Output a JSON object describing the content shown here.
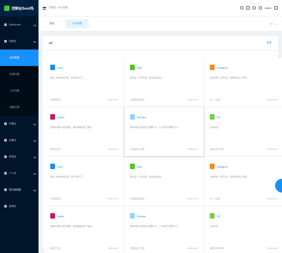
{
  "sidebar": {
    "logo_text": "控制台Seed鸟",
    "items": [
      {
        "label": "Dashboard",
        "expanded": false
      },
      {
        "label": "列表页",
        "expanded": true,
        "children": [
          {
            "label": "查询表格",
            "active": true
          },
          {
            "label": "标准列表",
            "active": false
          },
          {
            "label": "卡片列表",
            "active": false
          },
          {
            "label": "搜索列表",
            "active": false
          }
        ]
      },
      {
        "label": "详情页",
        "expanded": false
      },
      {
        "label": "结果页",
        "expanded": false
      },
      {
        "label": "异常页",
        "expanded": false
      },
      {
        "label": "个人页",
        "expanded": false
      },
      {
        "label": "图形编辑器",
        "expanded": false
      },
      {
        "label": "表单页",
        "expanded": false
      }
    ]
  },
  "header": {
    "breadcrumb": "列表页 / 卡片列表",
    "user": "Admin"
  },
  "tabs": [
    {
      "label": "首页",
      "active": false
    },
    {
      "label": "卡片列表",
      "active": true
    }
  ],
  "panel": {
    "title": "UP",
    "more": "更多"
  },
  "cards": [
    {
      "name": "CAD",
      "logo_color": "#1890ff",
      "desc": "那是一种内在的东西，他们到达不了。",
      "team": "科学搬砖组",
      "date": "2021-06-01"
    },
    {
      "name": "BIM",
      "logo_color": "#52c41a",
      "desc": "希望是一个好东西，也许是最好的。",
      "team": "全组都是吴彦祖",
      "date": "2021-06-01"
    },
    {
      "name": "Designer",
      "logo_color": "#fa8c16",
      "desc": "生命就像一盒巧克力，结果往往出人意料。",
      "team": "中二少女团",
      "date": "2021-06-01"
    },
    {
      "name": "Notes",
      "logo_color": "#d4145a",
      "desc": "城镇中有那么多的酒馆，她却偏偏走进了我的。",
      "team": "程序员日常",
      "date": "2021-06-01"
    },
    {
      "name": "Render",
      "logo_color": "#91d5ff",
      "desc": "那时候我只会想自己想要什么，从不想自己拥有什么。",
      "team": "高逼格设计天团",
      "date": "2021-06-01"
    },
    {
      "name": "PS",
      "logo_color": "#73d13d",
      "desc": "凛冬将至。",
      "team": "骗你来学计算机",
      "date": "2021-06-01"
    },
    {
      "name": "CAD",
      "logo_color": "#1890ff",
      "desc": "那是一种内在的东西，他们到达不了。",
      "team": "科学搬砖组",
      "date": "2021-06-01"
    },
    {
      "name": "BIM",
      "logo_color": "#52c41a",
      "desc": "希望是一个好东西，也许是最好的。",
      "team": "全组都是吴彦祖",
      "date": "2021-06-01"
    },
    {
      "name": "Designer",
      "logo_color": "#fa8c16",
      "desc": "生命就像一盒巧克力，结果往往出人意料。",
      "team": "中二少女团",
      "date": "2021-06-01"
    },
    {
      "name": "Notes",
      "logo_color": "#d4145a",
      "desc": "城镇中有那么多的酒馆，她却偏偏走进了我的。",
      "team": "程序员日常",
      "date": "2021-06-01"
    },
    {
      "name": "Render",
      "logo_color": "#91d5ff",
      "desc": "那时候我只会想自己想要什么，从不想自己拥有什么。",
      "team": "高逼格设计天团",
      "date": "2021-06-01"
    },
    {
      "name": "PS",
      "logo_color": "#73d13d",
      "desc": "凛冬将至。",
      "team": "骗你来学计算机",
      "date": "2021-06-01"
    }
  ]
}
